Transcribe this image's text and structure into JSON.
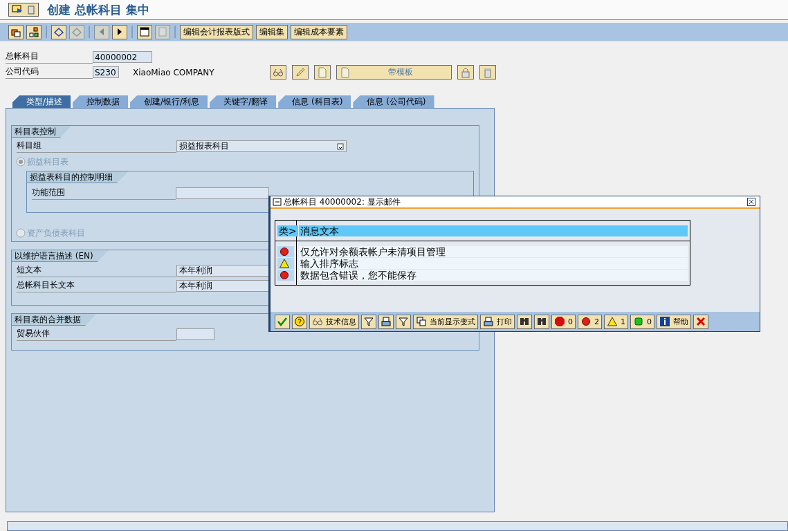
{
  "window": {
    "title": "创建 总帐科目 集中"
  },
  "toolbar": {
    "buttons": [
      {
        "kind": "icon",
        "disabled": false
      },
      {
        "kind": "icon",
        "disabled": false
      },
      {
        "kind": "icon",
        "disabled": false
      },
      {
        "kind": "icon",
        "disabled": true
      },
      {
        "kind": "icon",
        "disabled": true
      },
      {
        "kind": "icon",
        "disabled": false
      },
      {
        "kind": "icon",
        "disabled": false
      },
      {
        "kind": "icon",
        "disabled": true
      },
      {
        "kind": "text",
        "label": "编辑会计报表版式"
      },
      {
        "kind": "text",
        "label": "编辑集"
      },
      {
        "kind": "text",
        "label": "编辑成本要素"
      }
    ]
  },
  "header": {
    "account": {
      "label": "总帐科目",
      "value": "40000002"
    },
    "company": {
      "label": "公司代码",
      "value": "S230",
      "name": "XiaoMiao COMPANY"
    },
    "template_button": {
      "label": "带模板"
    }
  },
  "tabs": [
    {
      "label": "类型/描述",
      "selected": true
    },
    {
      "label": "控制数据",
      "selected": false
    },
    {
      "label": "创建/银行/利息",
      "selected": false
    },
    {
      "label": "关键字/翻译",
      "selected": false
    },
    {
      "label": "信息 (科目表)",
      "selected": false
    },
    {
      "label": "信息 (公司代码)",
      "selected": false
    }
  ],
  "sections": [
    {
      "title": "科目表控制",
      "fields": [
        {
          "label": "科目组",
          "value": "损益报表科目",
          "dropdown": true
        }
      ],
      "radios": [
        {
          "label": "损益科目表",
          "selected": true,
          "disabled": true,
          "detail": {
            "title": "损益表科目的控制明细",
            "fields": [
              {
                "label": "功能范围"
              }
            ]
          }
        },
        {
          "label": "资产负债表科目",
          "selected": false,
          "disabled": true
        }
      ]
    },
    {
      "title": "以维护语言描述 (EN)",
      "fields": [
        {
          "label": "短文本",
          "value": "本年利润"
        },
        {
          "label": "总帐科目长文本",
          "value": "本年利润"
        }
      ]
    },
    {
      "title": "科目表的合并数据",
      "fields": [
        {
          "label": "贸易伙伴"
        }
      ]
    }
  ],
  "dialog": {
    "title": "总帐科目 40000002: 显示邮件",
    "columns": [
      "类>",
      "消息文本"
    ],
    "messages": [
      {
        "kind": "error",
        "text": "仅允许对余额表帐户未清项目管理"
      },
      {
        "kind": "warning",
        "text": "输入排序标志"
      },
      {
        "kind": "error",
        "text": "数据包含错误，您不能保存"
      }
    ],
    "buttons": [
      {
        "kind": "icon"
      },
      {
        "kind": "icon"
      },
      {
        "kind": "labeled",
        "label": "技术信息"
      },
      {
        "kind": "icon"
      },
      {
        "kind": "icon"
      },
      {
        "kind": "icon"
      },
      {
        "kind": "labeled",
        "label": "当前显示变式"
      },
      {
        "kind": "labeled",
        "label": "打印"
      },
      {
        "kind": "icon"
      },
      {
        "kind": "icon"
      },
      {
        "kind": "labeled",
        "label": "0"
      },
      {
        "kind": "labeled",
        "label": "2"
      },
      {
        "kind": "labeled",
        "label": "1"
      },
      {
        "kind": "labeled",
        "label": "0"
      },
      {
        "kind": "labeled",
        "label": "帮助"
      },
      {
        "kind": "icon"
      }
    ]
  }
}
